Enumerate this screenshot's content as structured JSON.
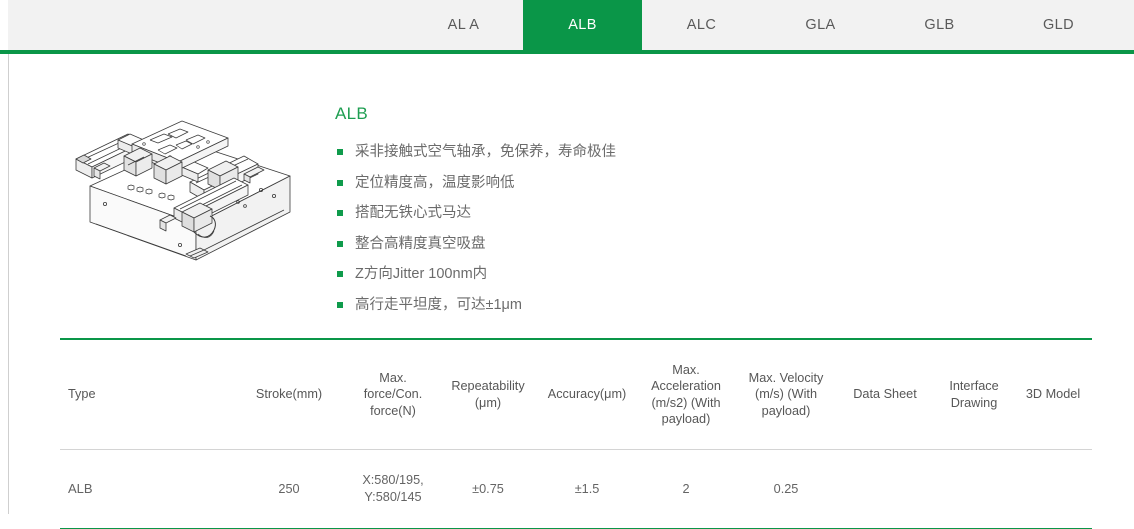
{
  "theme": {
    "accent_green": "#0a9648",
    "title_green": "#1e9e51",
    "bullet_green": "#0f9b4b",
    "tabbar_bg": "#f2f2f2",
    "body_text": "#6b6b6b"
  },
  "tabs": [
    {
      "label": "AL A",
      "active": false
    },
    {
      "label": "ALB",
      "active": true
    },
    {
      "label": "ALC",
      "active": false
    },
    {
      "label": "GLA",
      "active": false
    },
    {
      "label": "GLB",
      "active": false
    },
    {
      "label": "GLD",
      "active": false
    }
  ],
  "product": {
    "title": "ALB",
    "image_name": "alb-air-bearing-xy-stage-line-drawing",
    "features": [
      "采非接触式空气轴承，免保养，寿命极佳",
      "定位精度高，温度影响低",
      "搭配无铁心式马达",
      "整合高精度真空吸盘",
      "Z方向Jitter 100nm内",
      "高行走平坦度，可达±1μm"
    ]
  },
  "spec_table": {
    "headers": [
      "Type",
      "Stroke(mm)",
      "Max. force/Con. force(N)",
      "Repeatability (μm)",
      "Accuracy(μm)",
      "Max. Acceleration (m/s2) (With payload)",
      "Max. Velocity (m/s) (With payload)",
      "Data Sheet",
      "Interface Drawing",
      "3D Model"
    ],
    "rows": [
      {
        "type": "ALB",
        "stroke": "250",
        "force": "X:580/195, Y:580/145",
        "repeatability": "±0.75",
        "accuracy": "±1.5",
        "acceleration": "2",
        "velocity": "0.25",
        "data_sheet": "",
        "interface_drawing": "",
        "model_3d": ""
      }
    ]
  }
}
